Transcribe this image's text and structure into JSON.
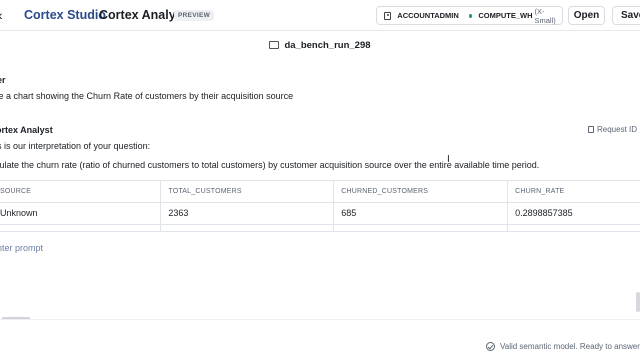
{
  "header": {
    "back_glyph": "‹",
    "app_title": "Cortex Studio",
    "page_title": "Cortex Analyst",
    "badge": "PREVIEW",
    "role": "ACCOUNTADMIN",
    "warehouse": "COMPUTE_WH",
    "warehouse_size": "(X-Small)",
    "open_label": "Open",
    "save_label": "Save"
  },
  "file": {
    "name": "da_bench_run_298"
  },
  "conversation": {
    "user_label": "er",
    "user_message": "ke a chart showing the Churn Rate of customers by their acquisition source",
    "analyst_label": "ortex Analyst",
    "request_id_label": "Request ID",
    "interpretation_intro": "s is our interpretation of your question:",
    "interpretation": "culate the churn rate (ratio of churned customers to total customers) by customer acquisition source over the entire available time period."
  },
  "table": {
    "columns": [
      "SOURCE",
      "TOTAL_CUSTOMERS",
      "CHURNED_CUSTOMERS",
      "CHURN_RATE"
    ],
    "rows": [
      [
        "Unknown",
        "2363",
        "685",
        "0.2898857385"
      ]
    ]
  },
  "prompt": {
    "placeholder": "nter prompt"
  },
  "status": {
    "text": "Valid semantic model. Ready to answer y"
  },
  "colors": {
    "brand": "#2b4a8a",
    "status_ok": "#18a05d",
    "border": "#e0e3e7"
  }
}
